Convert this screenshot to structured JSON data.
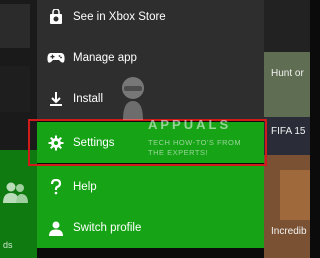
{
  "menu": {
    "items": [
      {
        "label": "See in Xbox Store",
        "icon": "xbox-store-bag-icon"
      },
      {
        "label": "Manage app",
        "icon": "gamepad-icon"
      },
      {
        "label": "Install",
        "icon": "download-install-icon"
      },
      {
        "label": "Settings",
        "icon": "gear-icon"
      },
      {
        "label": "Help",
        "icon": "question-mark-icon"
      },
      {
        "label": "Switch profile",
        "icon": "person-icon"
      }
    ],
    "highlighted_item": "Settings"
  },
  "background_tiles": {
    "right": [
      {
        "label": "Hunt or"
      },
      {
        "label": "FIFA 15"
      },
      {
        "label": "Incredib"
      }
    ],
    "left_fragment": "ds"
  },
  "watermark": {
    "brand": "APPUALS",
    "tagline_line1": "TECH HOW-TO'S FROM",
    "tagline_line2": "THE EXPERTS!"
  },
  "colors": {
    "menu_dark": "#2e2e2e",
    "menu_green": "#16a316",
    "highlight_border": "#d11a1a",
    "text": "#ffffff"
  }
}
